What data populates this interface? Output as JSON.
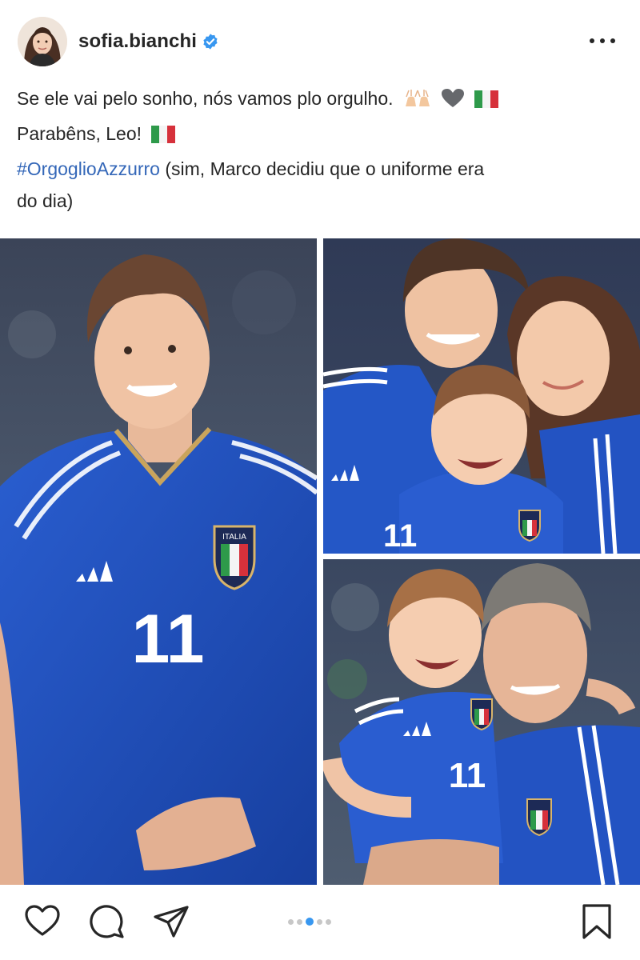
{
  "post": {
    "username": "sofia.bianchi",
    "verified": true,
    "caption": {
      "line1": "Se ele vai pelo sonho, nós vamos plo orgulho.",
      "line1_emojis": [
        "raising-hands-emoji",
        "grey-heart-emoji",
        "italy-flag-emoji"
      ],
      "line2": "Parabêns, Leo!",
      "line2_emojis": [
        "italy-flag-emoji"
      ],
      "hashtag": "#OrgoglioAzzurro",
      "line3_rest": " (sim, Marco decidiu que o uniforme era",
      "line4": "do dia)"
    },
    "photos": [
      {
        "name": "young-player-portrait",
        "jersey_number": "11",
        "crest_text": "ITALIA"
      },
      {
        "name": "family-selfie",
        "jersey_number": "11",
        "crest_text": "ITALIA"
      },
      {
        "name": "father-and-son",
        "jersey_number": "11",
        "crest_text": "ITALIA"
      }
    ],
    "carousel": {
      "total": 5,
      "active_index": 2
    },
    "icons": [
      "heart-icon",
      "comment-icon",
      "share-icon",
      "bookmark-icon",
      "more-icon",
      "verified-icon"
    ]
  },
  "colors": {
    "text": "#262626",
    "hashtag": "#3467b8",
    "verified": "#3897f0",
    "active_dot": "#3897f0",
    "jersey_blue": "#1f4fbd"
  }
}
